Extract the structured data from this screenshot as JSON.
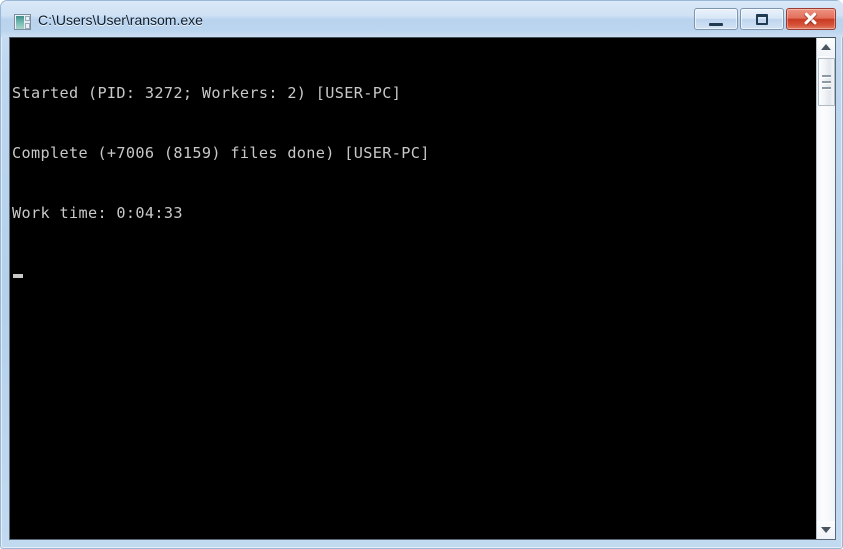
{
  "window": {
    "title": "C:\\Users\\User\\ransom.exe",
    "icon": "console-app-icon",
    "frame_color": "#b4d0ea",
    "titlebar_color": "#cfe1f4"
  },
  "controls": {
    "minimize_label": "",
    "maximize_label": "",
    "close_label": ""
  },
  "console": {
    "background": "#000000",
    "foreground": "#c8c8c8",
    "lines": [
      "Started (PID: 3272; Workers: 2) [USER-PC]",
      "Complete (+7006 (8159) files done) [USER-PC]",
      "Work time: 0:04:33"
    ],
    "values": {
      "pid": "3272",
      "workers": "2",
      "files_new": "+7006",
      "files_total": "8159",
      "host": "USER-PC",
      "work_time": "0:04:33"
    },
    "cursor": "_"
  },
  "scrollbar": {
    "up_arrow": "▲",
    "down_arrow": "▼"
  }
}
